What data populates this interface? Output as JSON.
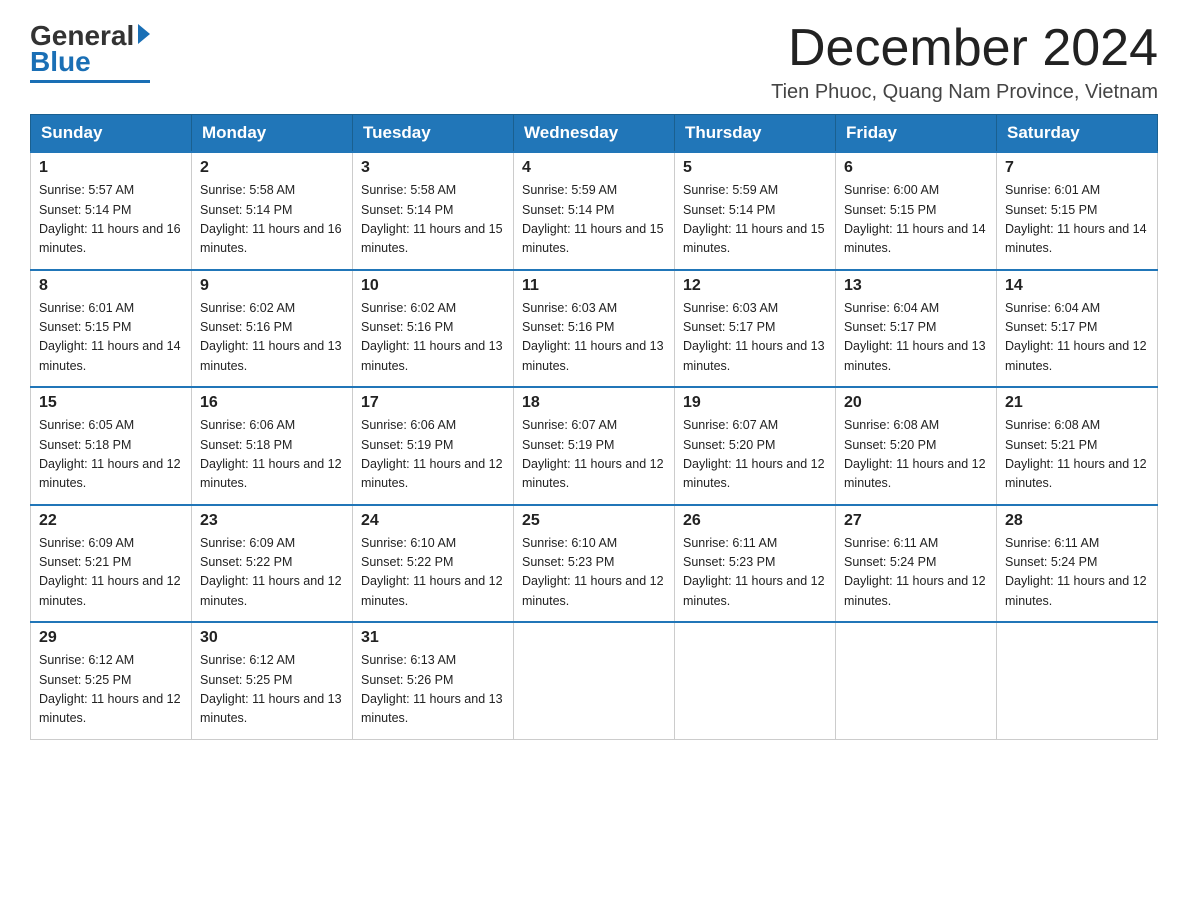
{
  "logo": {
    "text_general": "General",
    "text_blue": "Blue"
  },
  "header": {
    "title": "December 2024",
    "location": "Tien Phuoc, Quang Nam Province, Vietnam"
  },
  "columns": [
    "Sunday",
    "Monday",
    "Tuesday",
    "Wednesday",
    "Thursday",
    "Friday",
    "Saturday"
  ],
  "weeks": [
    [
      {
        "day": "1",
        "sunrise": "5:57 AM",
        "sunset": "5:14 PM",
        "daylight": "11 hours and 16 minutes."
      },
      {
        "day": "2",
        "sunrise": "5:58 AM",
        "sunset": "5:14 PM",
        "daylight": "11 hours and 16 minutes."
      },
      {
        "day": "3",
        "sunrise": "5:58 AM",
        "sunset": "5:14 PM",
        "daylight": "11 hours and 15 minutes."
      },
      {
        "day": "4",
        "sunrise": "5:59 AM",
        "sunset": "5:14 PM",
        "daylight": "11 hours and 15 minutes."
      },
      {
        "day": "5",
        "sunrise": "5:59 AM",
        "sunset": "5:14 PM",
        "daylight": "11 hours and 15 minutes."
      },
      {
        "day": "6",
        "sunrise": "6:00 AM",
        "sunset": "5:15 PM",
        "daylight": "11 hours and 14 minutes."
      },
      {
        "day": "7",
        "sunrise": "6:01 AM",
        "sunset": "5:15 PM",
        "daylight": "11 hours and 14 minutes."
      }
    ],
    [
      {
        "day": "8",
        "sunrise": "6:01 AM",
        "sunset": "5:15 PM",
        "daylight": "11 hours and 14 minutes."
      },
      {
        "day": "9",
        "sunrise": "6:02 AM",
        "sunset": "5:16 PM",
        "daylight": "11 hours and 13 minutes."
      },
      {
        "day": "10",
        "sunrise": "6:02 AM",
        "sunset": "5:16 PM",
        "daylight": "11 hours and 13 minutes."
      },
      {
        "day": "11",
        "sunrise": "6:03 AM",
        "sunset": "5:16 PM",
        "daylight": "11 hours and 13 minutes."
      },
      {
        "day": "12",
        "sunrise": "6:03 AM",
        "sunset": "5:17 PM",
        "daylight": "11 hours and 13 minutes."
      },
      {
        "day": "13",
        "sunrise": "6:04 AM",
        "sunset": "5:17 PM",
        "daylight": "11 hours and 13 minutes."
      },
      {
        "day": "14",
        "sunrise": "6:04 AM",
        "sunset": "5:17 PM",
        "daylight": "11 hours and 12 minutes."
      }
    ],
    [
      {
        "day": "15",
        "sunrise": "6:05 AM",
        "sunset": "5:18 PM",
        "daylight": "11 hours and 12 minutes."
      },
      {
        "day": "16",
        "sunrise": "6:06 AM",
        "sunset": "5:18 PM",
        "daylight": "11 hours and 12 minutes."
      },
      {
        "day": "17",
        "sunrise": "6:06 AM",
        "sunset": "5:19 PM",
        "daylight": "11 hours and 12 minutes."
      },
      {
        "day": "18",
        "sunrise": "6:07 AM",
        "sunset": "5:19 PM",
        "daylight": "11 hours and 12 minutes."
      },
      {
        "day": "19",
        "sunrise": "6:07 AM",
        "sunset": "5:20 PM",
        "daylight": "11 hours and 12 minutes."
      },
      {
        "day": "20",
        "sunrise": "6:08 AM",
        "sunset": "5:20 PM",
        "daylight": "11 hours and 12 minutes."
      },
      {
        "day": "21",
        "sunrise": "6:08 AM",
        "sunset": "5:21 PM",
        "daylight": "11 hours and 12 minutes."
      }
    ],
    [
      {
        "day": "22",
        "sunrise": "6:09 AM",
        "sunset": "5:21 PM",
        "daylight": "11 hours and 12 minutes."
      },
      {
        "day": "23",
        "sunrise": "6:09 AM",
        "sunset": "5:22 PM",
        "daylight": "11 hours and 12 minutes."
      },
      {
        "day": "24",
        "sunrise": "6:10 AM",
        "sunset": "5:22 PM",
        "daylight": "11 hours and 12 minutes."
      },
      {
        "day": "25",
        "sunrise": "6:10 AM",
        "sunset": "5:23 PM",
        "daylight": "11 hours and 12 minutes."
      },
      {
        "day": "26",
        "sunrise": "6:11 AM",
        "sunset": "5:23 PM",
        "daylight": "11 hours and 12 minutes."
      },
      {
        "day": "27",
        "sunrise": "6:11 AM",
        "sunset": "5:24 PM",
        "daylight": "11 hours and 12 minutes."
      },
      {
        "day": "28",
        "sunrise": "6:11 AM",
        "sunset": "5:24 PM",
        "daylight": "11 hours and 12 minutes."
      }
    ],
    [
      {
        "day": "29",
        "sunrise": "6:12 AM",
        "sunset": "5:25 PM",
        "daylight": "11 hours and 12 minutes."
      },
      {
        "day": "30",
        "sunrise": "6:12 AM",
        "sunset": "5:25 PM",
        "daylight": "11 hours and 13 minutes."
      },
      {
        "day": "31",
        "sunrise": "6:13 AM",
        "sunset": "5:26 PM",
        "daylight": "11 hours and 13 minutes."
      },
      null,
      null,
      null,
      null
    ]
  ]
}
